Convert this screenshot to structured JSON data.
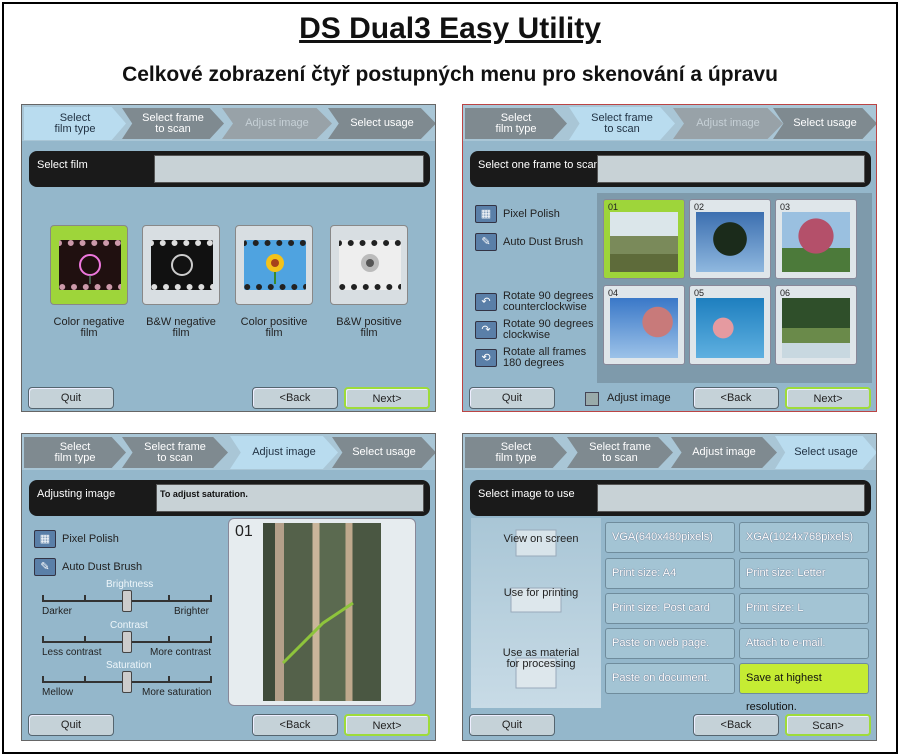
{
  "title": "DS Dual3 Easy Utility",
  "subtitle": "Celkové zobrazení čtyř postupných menu pro skenování a úpravu",
  "common": {
    "tabs": [
      "Select\nfilm type",
      "Select frame\nto scan",
      "Adjust image",
      "Select usage"
    ],
    "quit": "Quit",
    "back": "<Back",
    "next": "Next>"
  },
  "p1": {
    "header_label": "Select film",
    "films": [
      "Color negative\nfilm",
      "B&W negative\nfilm",
      "Color positive\nfilm",
      "B&W positive\nfilm"
    ]
  },
  "p2": {
    "header_label": "Select one frame to scan",
    "pixel_polish": "Pixel Polish",
    "auto_dust": "Auto Dust Brush",
    "rot_ccw": "Rotate 90 degrees\ncounterclockwise",
    "rot_cw": "Rotate 90 degrees\nclockwise",
    "rot_180": "Rotate all frames\n180 degrees",
    "frames": [
      "01",
      "02",
      "03",
      "04",
      "05",
      "06"
    ],
    "adjust_checkbox": "Adjust image"
  },
  "p3": {
    "header_label": "Adjusting image",
    "header_msg": "To adjust saturation.",
    "pixel_polish": "Pixel Polish",
    "auto_dust": "Auto Dust Brush",
    "brightness": "Brightness",
    "darker": "Darker",
    "brighter": "Brighter",
    "contrast": "Contrast",
    "less_contrast": "Less contrast",
    "more_contrast": "More contrast",
    "saturation": "Saturation",
    "mellow": "Mellow",
    "more_saturation": "More saturation",
    "preview_num": "01"
  },
  "p4": {
    "header_label": "Select image to use",
    "view_on_screen": "View on screen",
    "use_for_printing": "Use for printing",
    "use_as_material": "Use as material\nfor processing",
    "options": [
      "VGA(640x480pixels)",
      "XGA(1024x768pixels)",
      "Print size: A4",
      "Print size: Letter",
      "Print size: Post card",
      "Print size: L",
      "Paste on web page.",
      "Attach to e-mail.",
      "Paste on document.",
      "Save at highest resolution."
    ],
    "scan": "Scan>"
  },
  "colors": {
    "panel": "#94b7cb",
    "selected": "#9ed53a",
    "header": "#1a1a1a"
  }
}
